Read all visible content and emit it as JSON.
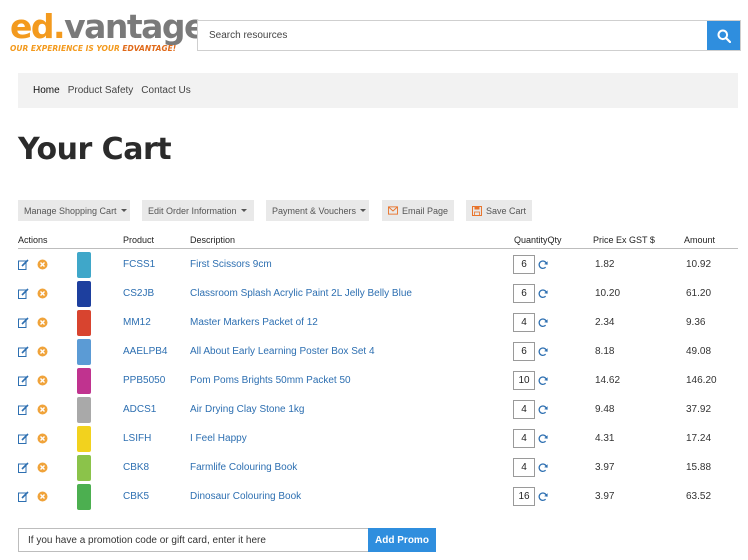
{
  "brand": {
    "logo_text_ed": "ed",
    "logo_text_dot": ".",
    "logo_text_rest": "vantage",
    "tagline_prefix": "OUR EXPERIENCE IS YOUR ",
    "tagline_emphasis": "EDVANTAGE!",
    "colors": {
      "orange": "#f39a1e",
      "grey": "#7a7a7a",
      "accent_blue": "#2f8ede",
      "link_blue": "#2d6fb1"
    }
  },
  "search": {
    "placeholder": "Search resources",
    "icon": "search-icon"
  },
  "nav": {
    "items": [
      {
        "label": "Home"
      },
      {
        "label": "Product Safety"
      },
      {
        "label": "Contact Us"
      }
    ]
  },
  "page": {
    "title": "Your Cart"
  },
  "toolbar": {
    "manage": "Manage Shopping Cart",
    "edit_order": "Edit Order Information",
    "payment": "Payment & Vouchers",
    "email": "Email Page",
    "save": "Save Cart"
  },
  "table": {
    "headers": {
      "actions": "Actions",
      "product": "Product",
      "description": "Description",
      "quantity": "QuantityQty",
      "price": "Price Ex GST $",
      "amount": "Amount"
    },
    "rows": [
      {
        "code": "FCSS1",
        "description": "First Scissors 9cm",
        "qty": "6",
        "price": "1.82",
        "amount": "10.92",
        "thumb_color": "#3fa7c9"
      },
      {
        "code": "CS2JB",
        "description": "Classroom Splash Acrylic Paint 2L Jelly Belly Blue",
        "qty": "6",
        "price": "10.20",
        "amount": "61.20",
        "thumb_color": "#1d3f9e"
      },
      {
        "code": "MM12",
        "description": "Master Markers Packet of 12",
        "qty": "4",
        "price": "2.34",
        "amount": "9.36",
        "thumb_color": "#d8442f"
      },
      {
        "code": "AAELPB4",
        "description": "All About Early Learning Poster Box Set 4",
        "qty": "6",
        "price": "8.18",
        "amount": "49.08",
        "thumb_color": "#5b9bd5"
      },
      {
        "code": "PPB5050",
        "description": "Pom Poms Brights 50mm Packet 50",
        "qty": "10",
        "price": "14.62",
        "amount": "146.20",
        "thumb_color": "#c0338f"
      },
      {
        "code": "ADCS1",
        "description": "Air Drying Clay Stone 1kg",
        "qty": "4",
        "price": "9.48",
        "amount": "37.92",
        "thumb_color": "#a9a9a9"
      },
      {
        "code": "LSIFH",
        "description": "I Feel Happy",
        "qty": "4",
        "price": "4.31",
        "amount": "17.24",
        "thumb_color": "#f2d21e"
      },
      {
        "code": "CBK8",
        "description": "Farmlife Colouring Book",
        "qty": "4",
        "price": "3.97",
        "amount": "15.88",
        "thumb_color": "#8bc34a"
      },
      {
        "code": "CBK5",
        "description": "Dinosaur Colouring Book",
        "qty": "16",
        "price": "3.97",
        "amount": "63.52",
        "thumb_color": "#4caf50"
      }
    ]
  },
  "promo": {
    "placeholder": "If you have a promotion code or gift card, enter it here",
    "button": "Add Promo"
  }
}
